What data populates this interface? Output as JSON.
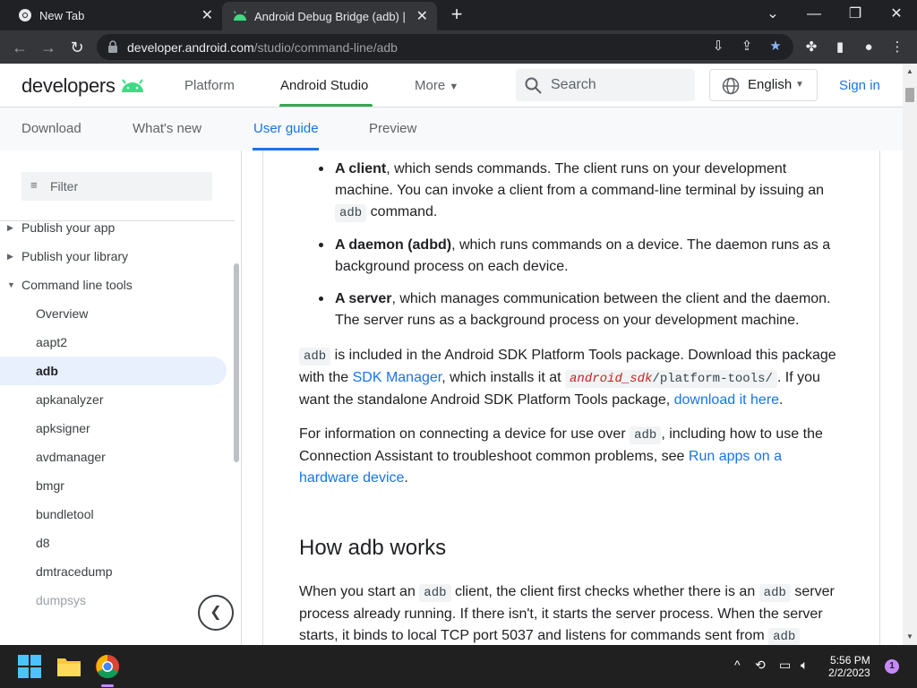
{
  "browser": {
    "tabs": [
      {
        "title": "New Tab",
        "icon": "chrome-icon"
      },
      {
        "title": "Android Debug Bridge (adb) | A",
        "icon": "android-icon"
      }
    ],
    "url_host": "developer.android.com",
    "url_path": "/studio/command-line/adb"
  },
  "header": {
    "logo": "developers",
    "nav": [
      "Platform",
      "Android Studio",
      "More"
    ],
    "search_placeholder": "Search",
    "language": "English",
    "signin": "Sign in"
  },
  "subnav": [
    "Download",
    "What's new",
    "User guide",
    "Preview"
  ],
  "sidebar": {
    "filter_placeholder": "Filter",
    "items": [
      {
        "label": "Publish your app",
        "level": 1,
        "expandable": true
      },
      {
        "label": "Publish your library",
        "level": 1,
        "expandable": true
      },
      {
        "label": "Command line tools",
        "level": 1,
        "expanded": true
      },
      {
        "label": "Overview",
        "level": 2
      },
      {
        "label": "aapt2",
        "level": 2
      },
      {
        "label": "adb",
        "level": 2,
        "active": true
      },
      {
        "label": "apkanalyzer",
        "level": 2
      },
      {
        "label": "apksigner",
        "level": 2
      },
      {
        "label": "avdmanager",
        "level": 2
      },
      {
        "label": "bmgr",
        "level": 2
      },
      {
        "label": "bundletool",
        "level": 2
      },
      {
        "label": "d8",
        "level": 2
      },
      {
        "label": "dmtracedump",
        "level": 2
      },
      {
        "label": "dumpsys",
        "level": 2
      }
    ]
  },
  "content": {
    "bullets": [
      {
        "bold": "A client",
        "text1": ", which sends commands. The client runs on your development machine. You can invoke a client from a command-line terminal by issuing an ",
        "code": "adb",
        "text2": " command."
      },
      {
        "bold": "A daemon (adbd)",
        "text1": ", which runs commands on a device. The daemon runs as a background process on each device."
      },
      {
        "bold": "A server",
        "text1": ", which manages communication between the client and the daemon. The server runs as a background process on your development machine."
      }
    ],
    "p1": {
      "code1": "adb",
      "t1": " is included in the Android SDK Platform Tools package. Download this package with the ",
      "link1": "SDK Manager",
      "t2": ", which installs it at ",
      "code_var": "android_sdk",
      "code_path": "/platform-tools/",
      "t3": ". If you want the standalone Android SDK Platform Tools package, ",
      "link2": "download it here",
      "t4": "."
    },
    "p2": {
      "t1": "For information on connecting a device for use over ",
      "code1": "adb",
      "t2": ", including how to use the Connection Assistant to troubleshoot common problems, see ",
      "link1": "Run apps on a hardware device",
      "t3": "."
    },
    "heading": "How adb works",
    "p3": {
      "t1": "When you start an ",
      "code1": "adb",
      "t2": " client, the client first checks whether there is an ",
      "code2": "adb",
      "t3": " server process already running. If there isn't, it starts the server process. When the server starts, it binds to local TCP port 5037 and listens for commands sent from ",
      "code3": "adb"
    }
  },
  "taskbar": {
    "time": "5:56 PM",
    "date": "2/2/2023",
    "notifications": "1"
  },
  "colors": {
    "accent": "#1a73e8",
    "android_green": "#34a853"
  }
}
